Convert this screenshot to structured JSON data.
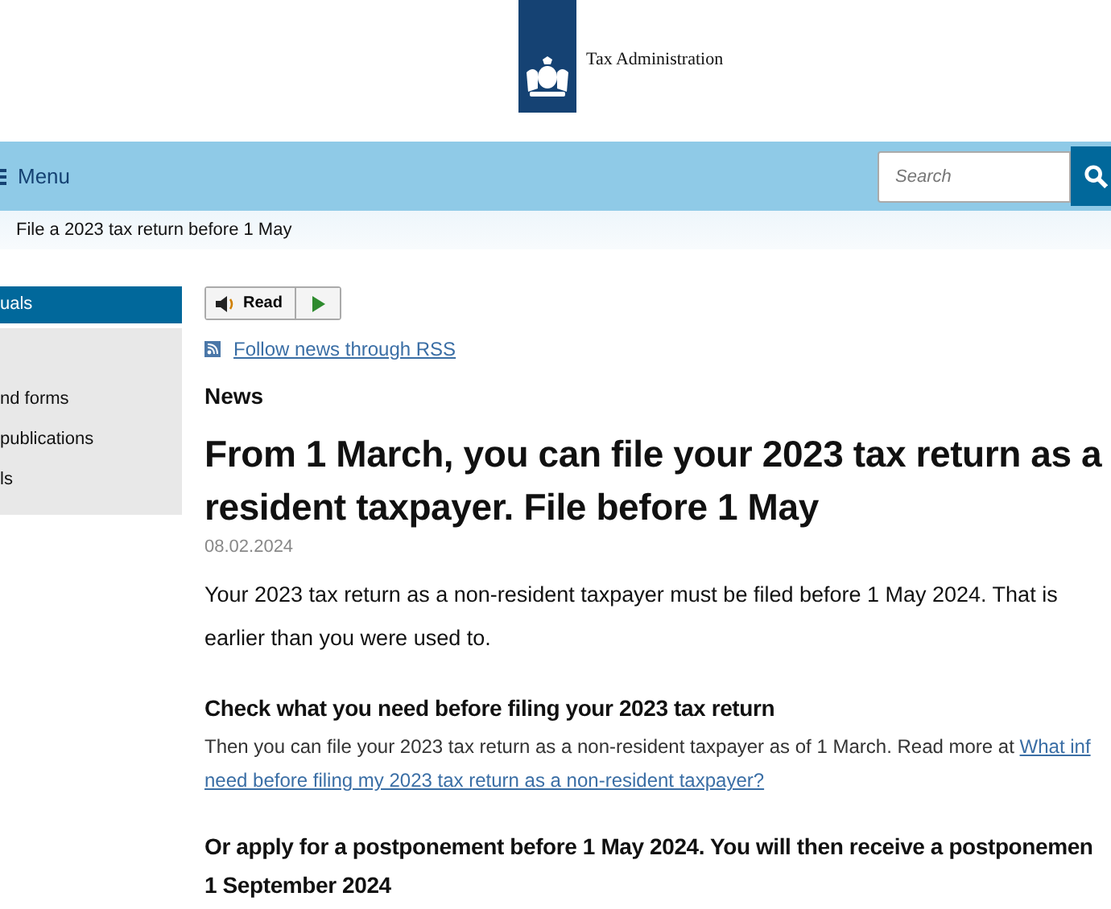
{
  "header": {
    "site_name": "Tax Administration"
  },
  "nav": {
    "menu_label": "Menu",
    "search": {
      "placeholder": "Search"
    }
  },
  "breadcrumb": "File a 2023 tax return before 1 May",
  "sidebar": {
    "items": [
      {
        "label": "uals",
        "selected": true
      },
      {
        "label": "nd forms",
        "selected": false
      },
      {
        "label": "publications",
        "selected": false
      },
      {
        "label": "ls",
        "selected": false
      }
    ]
  },
  "read_button": {
    "label": "Read"
  },
  "rss_link": "Follow news through RSS",
  "section_label": "News",
  "article": {
    "title_lines": [
      "From 1 March, you can file your 2023 tax return as a",
      "resident taxpayer. File before 1 May"
    ],
    "date": "08.02.2024",
    "intro_lines": [
      "Your 2023 tax return as a non-resident taxpayer must be filed before 1 May 2024. That is",
      "earlier than you were used to."
    ],
    "sections": [
      {
        "heading_lines": [
          "Check what you need before filing your 2023 tax return"
        ],
        "text": "Then you can file your 2023 tax return as a non-resident taxpayer as of 1 March. Read more at",
        "link_lines": [
          "What inf",
          "need before filing my 2023 tax return as a non-resident taxpayer?"
        ]
      },
      {
        "heading_lines": [
          "Or apply for a postponement before 1 May 2024. You will then receive a postponemen",
          "1 September 2024"
        ]
      }
    ]
  }
}
